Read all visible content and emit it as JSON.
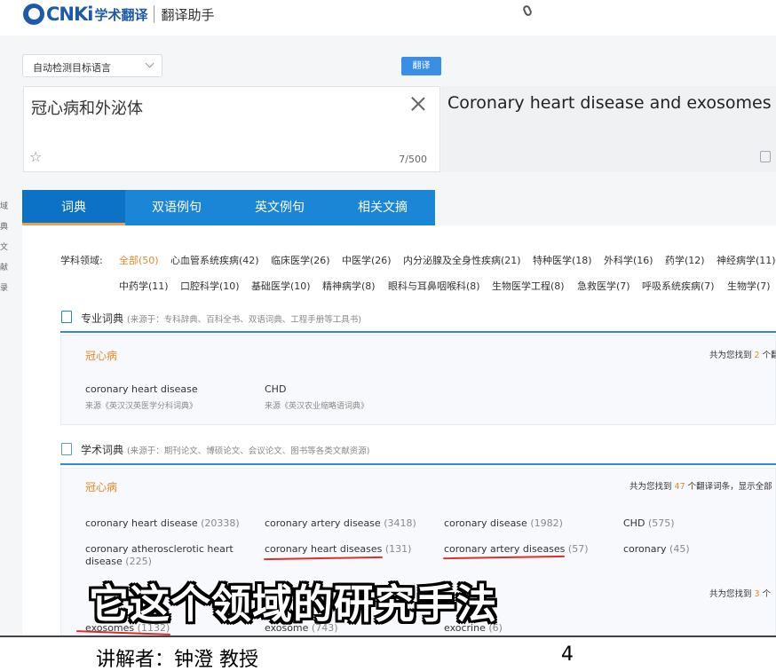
{
  "header": {
    "logo_brand": "CNKi",
    "logo_product": "学术翻译",
    "subtitle": "翻译助手"
  },
  "translator": {
    "target_lang_select": "自动检测目标语言",
    "translate_button": "翻译",
    "source_text": "冠心病和外泌体",
    "char_count": "7/500",
    "target_text": "Coronary heart disease and exosomes"
  },
  "left_strip": [
    "域",
    "典",
    "文",
    "献",
    "录"
  ],
  "tabs": [
    "词典",
    "双语例句",
    "英文例句",
    "相关文摘"
  ],
  "fields": {
    "label": "学科领域:",
    "row1": [
      "全部(50)",
      "心血管系统疾病(42)",
      "临床医学(26)",
      "中医学(26)",
      "内分泌腺及全身性疾病(21)",
      "特种医学(18)",
      "外科学(16)",
      "药学(12)",
      "神经病学(11)"
    ],
    "row2": [
      "中药学(11)",
      "口腔科学(10)",
      "基础医学(10)",
      "精神病学(8)",
      "眼科与耳鼻咽喉科(8)",
      "生物医学工程(8)",
      "急救医学(7)",
      "呼吸系统疾病(7)",
      "生物学(7)"
    ]
  },
  "pro_dict": {
    "title": "专业词典",
    "source_note": "(来源于：专科辞典、百科全书、双语词典、工程手册等工具书)",
    "head": "冠心病",
    "count": "共为您找到 2 个翻",
    "count_num": "2",
    "terms": [
      {
        "term": "coronary heart disease",
        "source": "来源《英汉汉英医学分科词典》"
      },
      {
        "term": "CHD",
        "source": "来源《英汉农业缩略语词典》"
      }
    ]
  },
  "academic_dict": {
    "title": "学术词典",
    "source_note": "(来源于：期刊论文、博硕论文、会议论文、图书等各类文献资源)",
    "head": "冠心病",
    "count": "共为您找到 47 个翻译词条，显示全部",
    "count_num": "47",
    "terms": [
      {
        "term": "coronary heart disease",
        "n": "(20338)"
      },
      {
        "term": "coronary artery disease",
        "n": "(3418)"
      },
      {
        "term": "coronary disease",
        "n": "(1982)"
      },
      {
        "term": "CHD",
        "n": "(575)"
      },
      {
        "term": "coronary atherosclerotic heart disease",
        "n": "(225)"
      },
      {
        "term": "coronary heart diseases",
        "n": "(131)"
      },
      {
        "term": "coronary artery diseases",
        "n": "(57)"
      },
      {
        "term": "coronary",
        "n": "(45)"
      }
    ],
    "second_count": "共为您找到 3 个",
    "second_count_num": "3",
    "second_terms": [
      {
        "term": "exosomes",
        "n": "(1132)"
      },
      {
        "term": "exosome",
        "n": "(743)"
      },
      {
        "term": "exocrine",
        "n": "(6)"
      }
    ]
  },
  "video": {
    "subtitle": "它这个领域的研究手法",
    "lecturer": "讲解者：钟澄 教授",
    "page_number": "4"
  },
  "colors": {
    "tab_blue": "#1b86d6",
    "accent_orange": "#e88a2a",
    "annotation_red": "#d9302e"
  }
}
